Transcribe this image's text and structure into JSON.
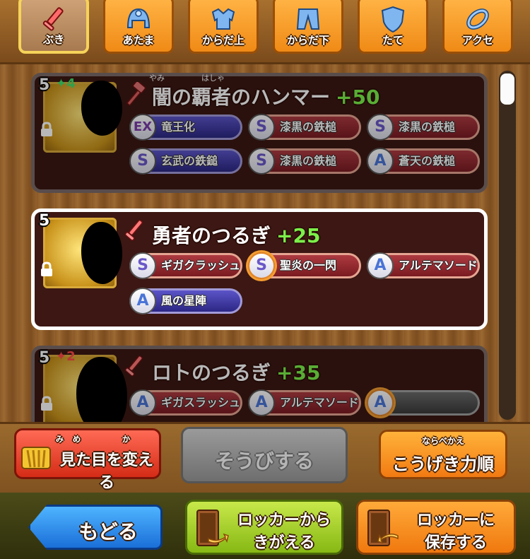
{
  "tabs": [
    {
      "label": "ぶき",
      "icon": "sword-icon",
      "active": true
    },
    {
      "label": "あたま",
      "icon": "helmet-icon",
      "active": false
    },
    {
      "label": "からだ上",
      "icon": "armor-top-icon",
      "active": false
    },
    {
      "label": "からだ下",
      "icon": "armor-bottom-icon",
      "active": false
    },
    {
      "label": "たて",
      "icon": "shield-icon",
      "active": false
    },
    {
      "label": "アクセ",
      "icon": "accessory-icon",
      "active": false
    }
  ],
  "items": [
    {
      "level": "5",
      "star": "✦4",
      "star_color": "#3ee06b",
      "name": "闇の覇者のハンマー",
      "ruby": [
        "やみ",
        "はしゃ"
      ],
      "plus": "+50",
      "locked": true,
      "weapon_icon": "hammer-icon",
      "skills": [
        {
          "rank": "EX",
          "name": "竜王化",
          "color": "blue"
        },
        {
          "rank": "S",
          "name": "漆黒の鉄槌",
          "color": "red"
        },
        {
          "rank": "S",
          "name": "漆黒の鉄槌",
          "color": "red"
        },
        {
          "rank": "S",
          "name": "玄武の鉄鎚",
          "color": "blue"
        },
        {
          "rank": "S",
          "name": "漆黒の鉄槌",
          "color": "red"
        },
        {
          "rank": "A",
          "name": "蒼天の鉄槌",
          "color": "red"
        }
      ]
    },
    {
      "level": "5",
      "star": "",
      "name": "勇者のつるぎ",
      "ruby": [],
      "plus": "+25",
      "locked": true,
      "weapon_icon": "sword-icon",
      "skills": [
        {
          "rank": "S",
          "name": "ギガクラッシュ",
          "color": "red"
        },
        {
          "rank": "S",
          "name": "聖炎の一閃",
          "color": "red"
        },
        {
          "rank": "A",
          "name": "アルテマソード",
          "color": "red"
        },
        {
          "rank": "A",
          "name": "風の星陣",
          "color": "blue"
        }
      ]
    },
    {
      "level": "5",
      "star": "✦2",
      "star_color": "#ff4a4a",
      "name": "ロトのつるぎ",
      "ruby": [],
      "plus": "+35",
      "locked": true,
      "weapon_icon": "sword-icon",
      "skills": [
        {
          "rank": "A",
          "name": "ギガスラッシュ",
          "color": "red"
        },
        {
          "rank": "A",
          "name": "アルテマソード",
          "color": "red"
        },
        {
          "rank": "A",
          "name": "",
          "color": "gray"
        }
      ]
    }
  ],
  "actions": {
    "appearance": {
      "label": "見た目を変える",
      "ruby": [
        "み",
        "め",
        "か"
      ]
    },
    "equip": {
      "label": "そうびする"
    },
    "sort": {
      "label": "こうげき力順",
      "ruby": "ならべかえ"
    }
  },
  "nav": {
    "back": "もどる",
    "locker_swap": [
      "ロッカーから",
      "きがえる"
    ],
    "locker_save": [
      "ロッカーに",
      "保存する"
    ]
  }
}
